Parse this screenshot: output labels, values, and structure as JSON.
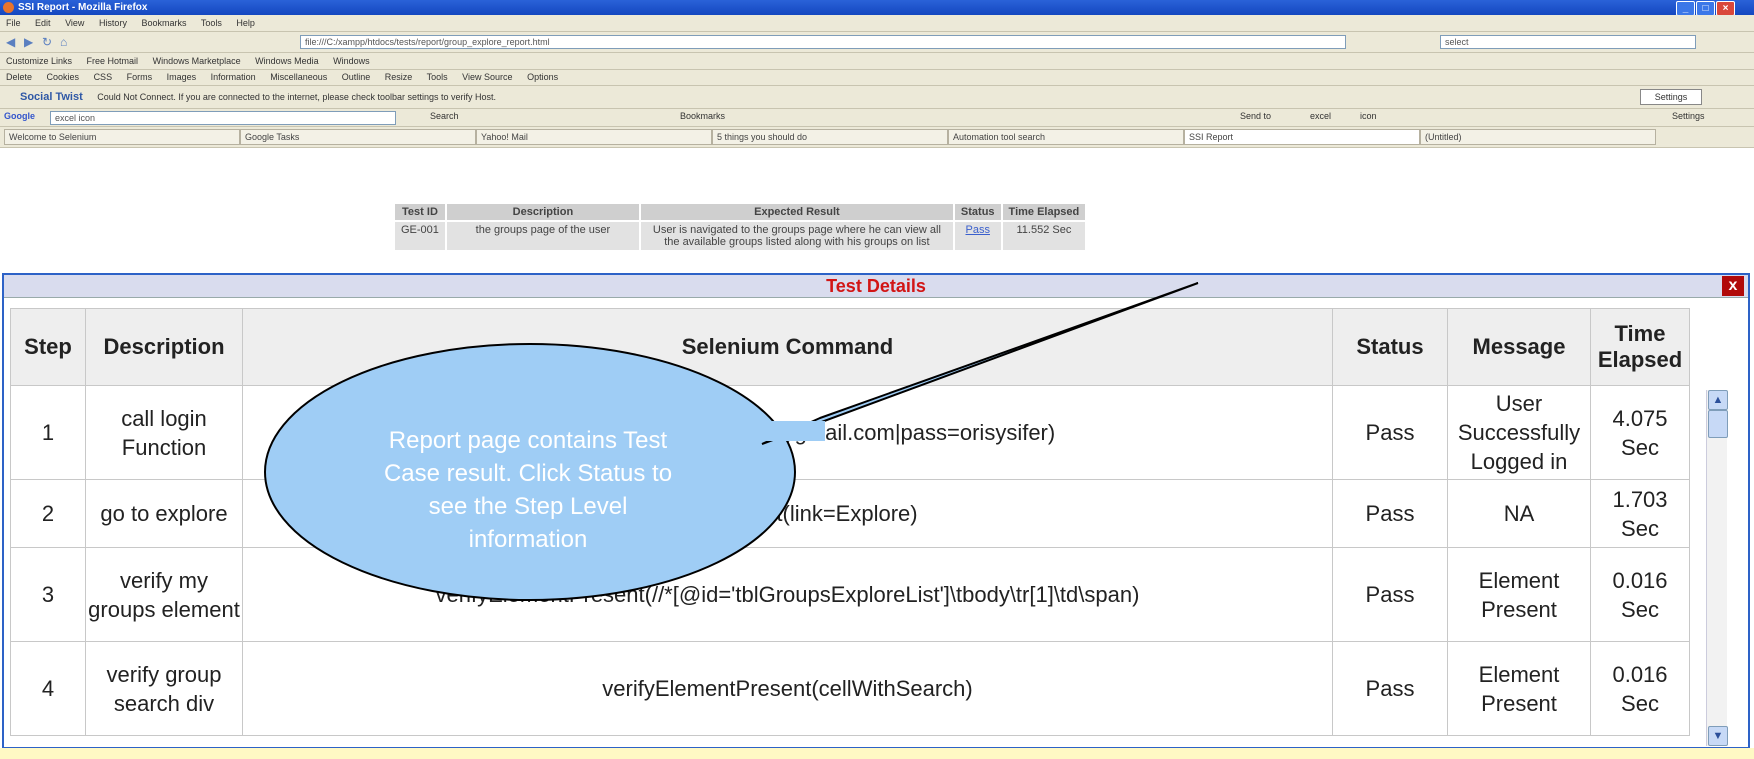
{
  "window": {
    "title": "SSI Report - Mozilla Firefox"
  },
  "menu": [
    "File",
    "Edit",
    "View",
    "History",
    "Bookmarks",
    "Tools",
    "Help"
  ],
  "nav": {
    "url": "file:///C:/xampp/htdocs/tests/report/group_explore_report.html",
    "search_value": "select"
  },
  "bookmarks": [
    "Customize Links",
    "Free Hotmail",
    "Windows Marketplace",
    "Windows Media",
    "Windows"
  ],
  "toolbar_row": [
    "Delete",
    "Cookies",
    "CSS",
    "Forms",
    "Images",
    "Information",
    "Miscellaneous",
    "Outline",
    "Resize",
    "Tools",
    "View Source",
    "Options"
  ],
  "status_row": {
    "brand": "Social Twist",
    "message": "Could Not Connect. If you are connected to the internet, please check toolbar settings to verify Host.",
    "settings_label": "Settings"
  },
  "google_bar": {
    "label": "Google",
    "query": "excel icon",
    "items": [
      "Search",
      "Bookmarks",
      "Send to",
      "excel",
      "icon"
    ],
    "settings_label": "Settings"
  },
  "tabs": [
    "Welcome to Selenium",
    "Google Tasks",
    "Yahoo! Mail",
    "5 things you should do",
    "Automation tool search",
    "SSI Report",
    "(Untitled)"
  ],
  "report_table": {
    "headers": [
      "Test ID",
      "Description",
      "Expected Result",
      "Status",
      "Time Elapsed"
    ],
    "row": {
      "id": "GE-001",
      "description": "the groups page of the user",
      "expected": "User is navigated to the groups page where he can view all the available groups listed along with his groups on list",
      "status": "Pass",
      "time": "11.552 Sec"
    }
  },
  "dialog": {
    "title": "Test Details",
    "close_label": "x",
    "headers": [
      "Step",
      "Description",
      "Selenium Command",
      "Status",
      "Message",
      "Time Elapsed"
    ],
    "rows": [
      {
        "step": "1",
        "description": "call login Function",
        "command": "login(username=orisysifer@gmail.com|pass=orisysifer)",
        "status": "Pass",
        "message": "User Successfully Logged in",
        "time": "4.075 Sec"
      },
      {
        "step": "2",
        "description": "go to explore",
        "command": "clickAndWait(link=Explore)",
        "status": "Pass",
        "message": "NA",
        "time": "1.703 Sec"
      },
      {
        "step": "3",
        "description": "verify my groups element",
        "command": "verifyElementPresent(//*[@id='tblGroupsExploreList']\\tbody\\tr[1]\\td\\span)",
        "status": "Pass",
        "message": "Element Present",
        "time": "0.016 Sec"
      },
      {
        "step": "4",
        "description": "verify group search div",
        "command": "verifyElementPresent(cellWithSearch)",
        "status": "Pass",
        "message": "Element Present",
        "time": "0.016 Sec"
      }
    ]
  },
  "callout": {
    "text": "Report page contains Test Case result. Click Status to see the Step Level information"
  },
  "colors": {
    "dialog_border": "#2d62c7",
    "dialog_title": "#d21515",
    "callout_fill": "#9fcdf5"
  }
}
